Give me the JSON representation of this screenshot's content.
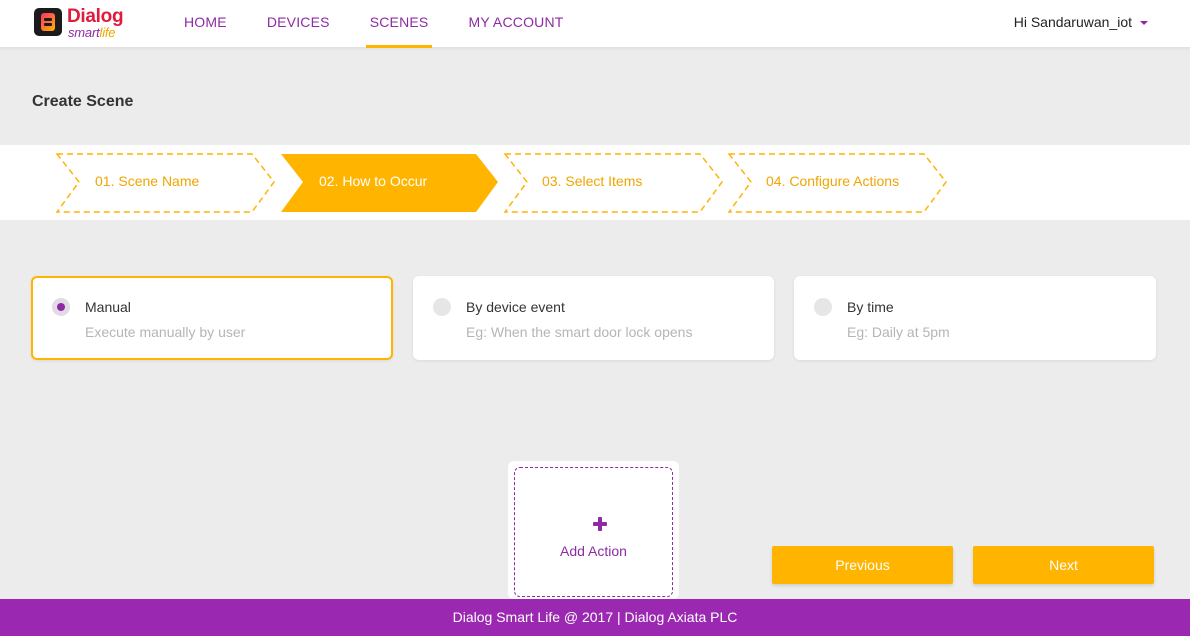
{
  "header": {
    "logo": {
      "word1": "Dialog",
      "word2a": "smart",
      "word2b": "life"
    },
    "nav": [
      {
        "label": "HOME",
        "active": false
      },
      {
        "label": "DEVICES",
        "active": false
      },
      {
        "label": "SCENES",
        "active": true
      },
      {
        "label": "MY ACCOUNT",
        "active": false
      }
    ],
    "user_greeting": "Hi Sandaruwan_iot"
  },
  "page": {
    "title": "Create Scene"
  },
  "steps": [
    {
      "label": "01. Scene Name",
      "active": false
    },
    {
      "label": "02. How to Occur",
      "active": true
    },
    {
      "label": "03. Select Items",
      "active": false
    },
    {
      "label": "04. Configure Actions",
      "active": false
    }
  ],
  "options": [
    {
      "title": "Manual",
      "description": "Execute manually by user",
      "selected": true
    },
    {
      "title": "By device event",
      "description": "Eg: When the smart door lock opens",
      "selected": false
    },
    {
      "title": "By time",
      "description": "Eg: Daily at 5pm",
      "selected": false
    }
  ],
  "add_action": {
    "label": "Add Action",
    "icon": "plus-icon"
  },
  "buttons": {
    "previous": "Previous",
    "next": "Next"
  },
  "footer": {
    "text": "Dialog Smart Life @ 2017 | Dialog Axiata PLC"
  },
  "colors": {
    "accent": "#ffb400",
    "brand": "#8e2ba3",
    "footer": "#9b28b0"
  }
}
